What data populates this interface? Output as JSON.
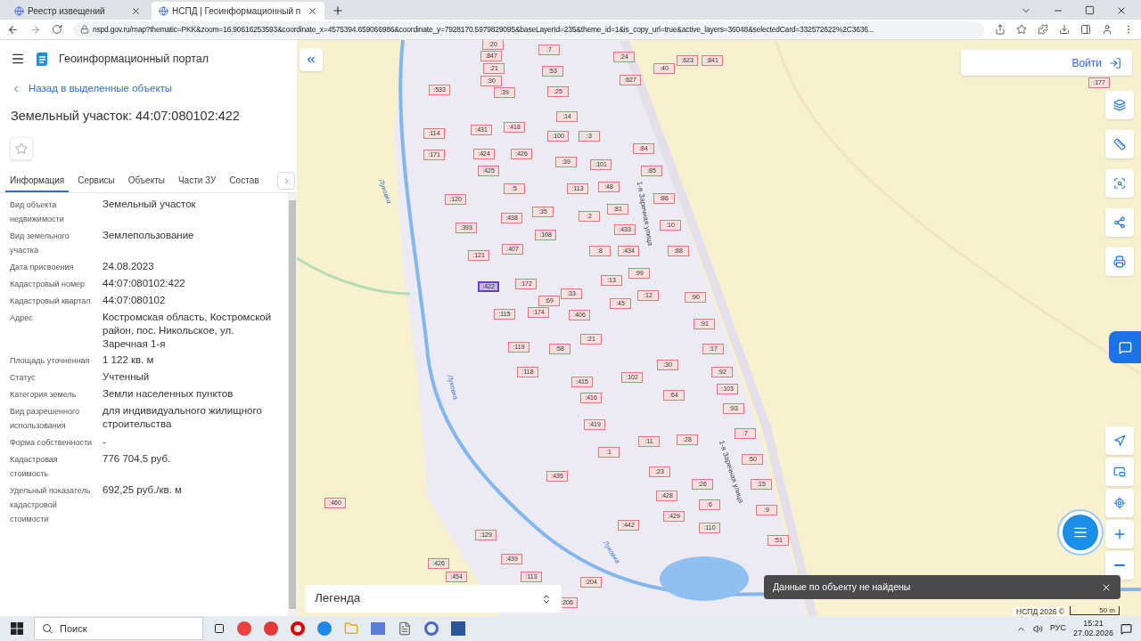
{
  "browser": {
    "tabs": [
      {
        "title": "Реестр извещений",
        "selected": false
      },
      {
        "title": "НСПД | Геоинформационный п",
        "selected": true
      }
    ],
    "url": "nspd.gov.ru/map?thematic=PKK&zoom=16.90616253593&coordinate_x=4575394.659066986&coordinate_y=7928170.5979829095&baseLayerId=235&theme_id=1&is_copy_url=true&active_layers=36048&selectedCard=332572622%2C3636..."
  },
  "app": {
    "title": "Геоинформационный портал",
    "back_link": "Назад в выделенные объекты",
    "heading": "Земельный участок: 44:07:080102:422",
    "favorite": false,
    "tabs": [
      {
        "label": "Информация",
        "selected": true
      },
      {
        "label": "Сервисы",
        "selected": false
      },
      {
        "label": "Объекты",
        "selected": false
      },
      {
        "label": "Части ЗУ",
        "selected": false
      },
      {
        "label": "Состав",
        "selected": false
      }
    ],
    "fields": [
      {
        "label": "Вид объекта недвижимости",
        "value": "Земельный участок"
      },
      {
        "label": "Вид земельного участка",
        "value": "Землепользование"
      },
      {
        "label": "Дата присвоения",
        "value": "24.08.2023"
      },
      {
        "label": "Кадастровый номер",
        "value": "44:07:080102:422"
      },
      {
        "label": "Кадастровый квартал",
        "value": "44:07:080102"
      },
      {
        "label": "Адрес",
        "value": "Костромская область, Костромской район, пос. Никольское, ул. Заречная 1-я"
      },
      {
        "label": "Площадь уточненная",
        "value": "1 122 кв. м"
      },
      {
        "label": "Статус",
        "value": "Учтенный"
      },
      {
        "label": "Категория земель",
        "value": "Земли населенных пунктов"
      },
      {
        "label": "Вид разрешенного использования",
        "value": "для индивидуального жилищного строительства"
      },
      {
        "label": "Форма собственности",
        "value": "-"
      },
      {
        "label": "Кадастровая стоимость",
        "value": "776 704,5 руб."
      },
      {
        "label": "Удельный показатель кадастровой стоимости",
        "value": "692,25 руб./кв. м"
      }
    ]
  },
  "map": {
    "login": "Войти",
    "legend": "Легенда",
    "toast": "Данные по объекту не найдены",
    "copyright": "НСПД 2026 ©",
    "scale": "50 m",
    "labels": [
      {
        "text": "1-я Заречная улица",
        "kind": "street"
      },
      {
        "text": "1-я Заречная улица",
        "kind": "street"
      },
      {
        "text": "Луковка",
        "kind": "river"
      },
      {
        "text": "Луковка",
        "kind": "river"
      },
      {
        "text": "Луковка",
        "kind": "river"
      }
    ],
    "parcels": [
      {
        "label": ":20",
        "selected": false
      },
      {
        "label": ":847",
        "selected": false
      },
      {
        "label": ":7",
        "selected": false
      },
      {
        "label": ":21",
        "selected": false
      },
      {
        "label": ":53",
        "selected": false
      },
      {
        "label": ":30",
        "selected": false
      },
      {
        "label": ":39",
        "selected": false
      },
      {
        "label": ":25",
        "selected": false
      },
      {
        "label": ":533",
        "selected": false
      },
      {
        "label": ":24",
        "selected": false
      },
      {
        "label": ":627",
        "selected": false
      },
      {
        "label": ":40",
        "selected": false
      },
      {
        "label": ":623",
        "selected": false
      },
      {
        "label": ":841",
        "selected": false
      },
      {
        "label": ":177",
        "selected": false
      },
      {
        "label": ":14",
        "selected": false
      },
      {
        "label": ":431",
        "selected": false
      },
      {
        "label": ":418",
        "selected": false
      },
      {
        "label": ":100",
        "selected": false
      },
      {
        "label": ":3",
        "selected": false
      },
      {
        "label": ":114",
        "selected": false
      },
      {
        "label": ":171",
        "selected": false
      },
      {
        "label": ":424",
        "selected": false
      },
      {
        "label": ":426",
        "selected": false
      },
      {
        "label": ":39",
        "selected": false
      },
      {
        "label": ":101",
        "selected": false
      },
      {
        "label": ":84",
        "selected": false
      },
      {
        "label": ":425",
        "selected": false
      },
      {
        "label": ":113",
        "selected": false
      },
      {
        "label": ":48",
        "selected": false
      },
      {
        "label": ":85",
        "selected": false
      },
      {
        "label": ":5",
        "selected": false
      },
      {
        "label": ":120",
        "selected": false
      },
      {
        "label": ":35",
        "selected": false
      },
      {
        "label": ":81",
        "selected": false
      },
      {
        "label": ":86",
        "selected": false
      },
      {
        "label": ":438",
        "selected": false
      },
      {
        "label": ":2",
        "selected": false
      },
      {
        "label": ":393",
        "selected": false
      },
      {
        "label": ":433",
        "selected": false
      },
      {
        "label": ":10",
        "selected": false
      },
      {
        "label": ":108",
        "selected": false
      },
      {
        "label": ":407",
        "selected": false
      },
      {
        "label": ":8",
        "selected": false
      },
      {
        "label": ":434",
        "selected": false
      },
      {
        "label": ":88",
        "selected": false
      },
      {
        "label": ":121",
        "selected": false
      },
      {
        "label": ":99",
        "selected": false
      },
      {
        "label": ":172",
        "selected": false
      },
      {
        "label": ":13",
        "selected": false
      },
      {
        "label": ":422",
        "selected": true
      },
      {
        "label": ":33",
        "selected": false
      },
      {
        "label": ":12",
        "selected": false
      },
      {
        "label": ":69",
        "selected": false
      },
      {
        "label": ":45",
        "selected": false
      },
      {
        "label": ":90",
        "selected": false
      },
      {
        "label": ":115",
        "selected": false
      },
      {
        "label": ":174",
        "selected": false
      },
      {
        "label": ":406",
        "selected": false
      },
      {
        "label": ":91",
        "selected": false
      },
      {
        "label": ":21",
        "selected": false
      },
      {
        "label": ":119",
        "selected": false
      },
      {
        "label": ":58",
        "selected": false
      },
      {
        "label": ":17",
        "selected": false
      },
      {
        "label": ":118",
        "selected": false
      },
      {
        "label": ":30",
        "selected": false
      },
      {
        "label": ":92",
        "selected": false
      },
      {
        "label": ":415",
        "selected": false
      },
      {
        "label": ":102",
        "selected": false
      },
      {
        "label": ":64",
        "selected": false
      },
      {
        "label": ":103",
        "selected": false
      },
      {
        "label": ":416",
        "selected": false
      },
      {
        "label": ":93",
        "selected": false
      },
      {
        "label": ":419",
        "selected": false
      },
      {
        "label": ":7",
        "selected": false
      },
      {
        "label": ":28",
        "selected": false
      },
      {
        "label": ":11",
        "selected": false
      },
      {
        "label": ":1",
        "selected": false
      },
      {
        "label": ":50",
        "selected": false
      },
      {
        "label": ":23",
        "selected": false
      },
      {
        "label": ":435",
        "selected": false
      },
      {
        "label": ":15",
        "selected": false
      },
      {
        "label": ":26",
        "selected": false
      },
      {
        "label": ":428",
        "selected": false
      },
      {
        "label": ":6",
        "selected": false
      },
      {
        "label": ":460",
        "selected": false
      },
      {
        "label": ":9",
        "selected": false
      },
      {
        "label": ":429",
        "selected": false
      },
      {
        "label": ":442",
        "selected": false
      },
      {
        "label": ":110",
        "selected": false
      },
      {
        "label": ":51",
        "selected": false
      },
      {
        "label": ":129",
        "selected": false
      },
      {
        "label": ":439",
        "selected": false
      },
      {
        "label": ":426",
        "selected": false
      },
      {
        "label": ":454",
        "selected": false
      },
      {
        "label": ":113",
        "selected": false
      },
      {
        "label": ":204",
        "selected": false
      },
      {
        "label": ":206",
        "selected": false
      }
    ]
  },
  "taskbar": {
    "search_placeholder": "Поиск",
    "language": "РУС",
    "time": "15:21",
    "date": "27.02.2026"
  }
}
